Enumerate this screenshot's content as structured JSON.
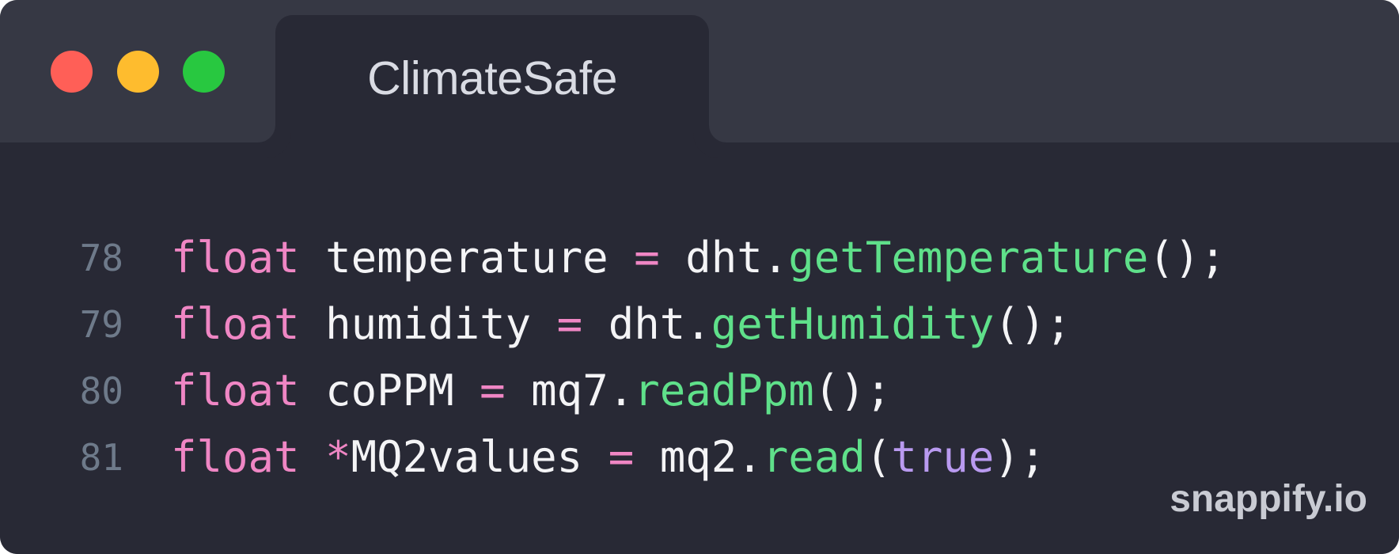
{
  "window": {
    "traffic_lights": {
      "close_color": "#ff5f57",
      "minimize_color": "#febc2e",
      "maximize_color": "#28c840"
    },
    "tab_title": "ClimateSafe"
  },
  "code": {
    "lines": [
      {
        "number": "78",
        "tokens": [
          {
            "text": "float",
            "type": "keyword"
          },
          {
            "text": " temperature ",
            "type": "plain"
          },
          {
            "text": "=",
            "type": "operator"
          },
          {
            "text": " dht.",
            "type": "plain"
          },
          {
            "text": "getTemperature",
            "type": "function"
          },
          {
            "text": "();",
            "type": "plain"
          }
        ]
      },
      {
        "number": "79",
        "tokens": [
          {
            "text": "float",
            "type": "keyword"
          },
          {
            "text": " humidity ",
            "type": "plain"
          },
          {
            "text": "=",
            "type": "operator"
          },
          {
            "text": " dht.",
            "type": "plain"
          },
          {
            "text": "getHumidity",
            "type": "function"
          },
          {
            "text": "();",
            "type": "plain"
          }
        ]
      },
      {
        "number": "80",
        "tokens": [
          {
            "text": "float",
            "type": "keyword"
          },
          {
            "text": " coPPM ",
            "type": "plain"
          },
          {
            "text": "=",
            "type": "operator"
          },
          {
            "text": " mq7.",
            "type": "plain"
          },
          {
            "text": "readPpm",
            "type": "function"
          },
          {
            "text": "();",
            "type": "plain"
          }
        ]
      },
      {
        "number": "81",
        "tokens": [
          {
            "text": "float",
            "type": "keyword"
          },
          {
            "text": " ",
            "type": "plain"
          },
          {
            "text": "*",
            "type": "operator"
          },
          {
            "text": "MQ2values ",
            "type": "plain"
          },
          {
            "text": "=",
            "type": "operator"
          },
          {
            "text": " mq2.",
            "type": "plain"
          },
          {
            "text": "read",
            "type": "function"
          },
          {
            "text": "(",
            "type": "plain"
          },
          {
            "text": "true",
            "type": "boolean"
          },
          {
            "text": ");",
            "type": "plain"
          }
        ]
      }
    ]
  },
  "watermark": "snappify.io",
  "colors": {
    "background": "#282935",
    "titlebar": "#363844",
    "keyword": "#ef86c4",
    "function": "#5fe08a",
    "boolean": "#b99af0",
    "line_number": "#6e7a8a",
    "text": "#f4f4f6"
  }
}
